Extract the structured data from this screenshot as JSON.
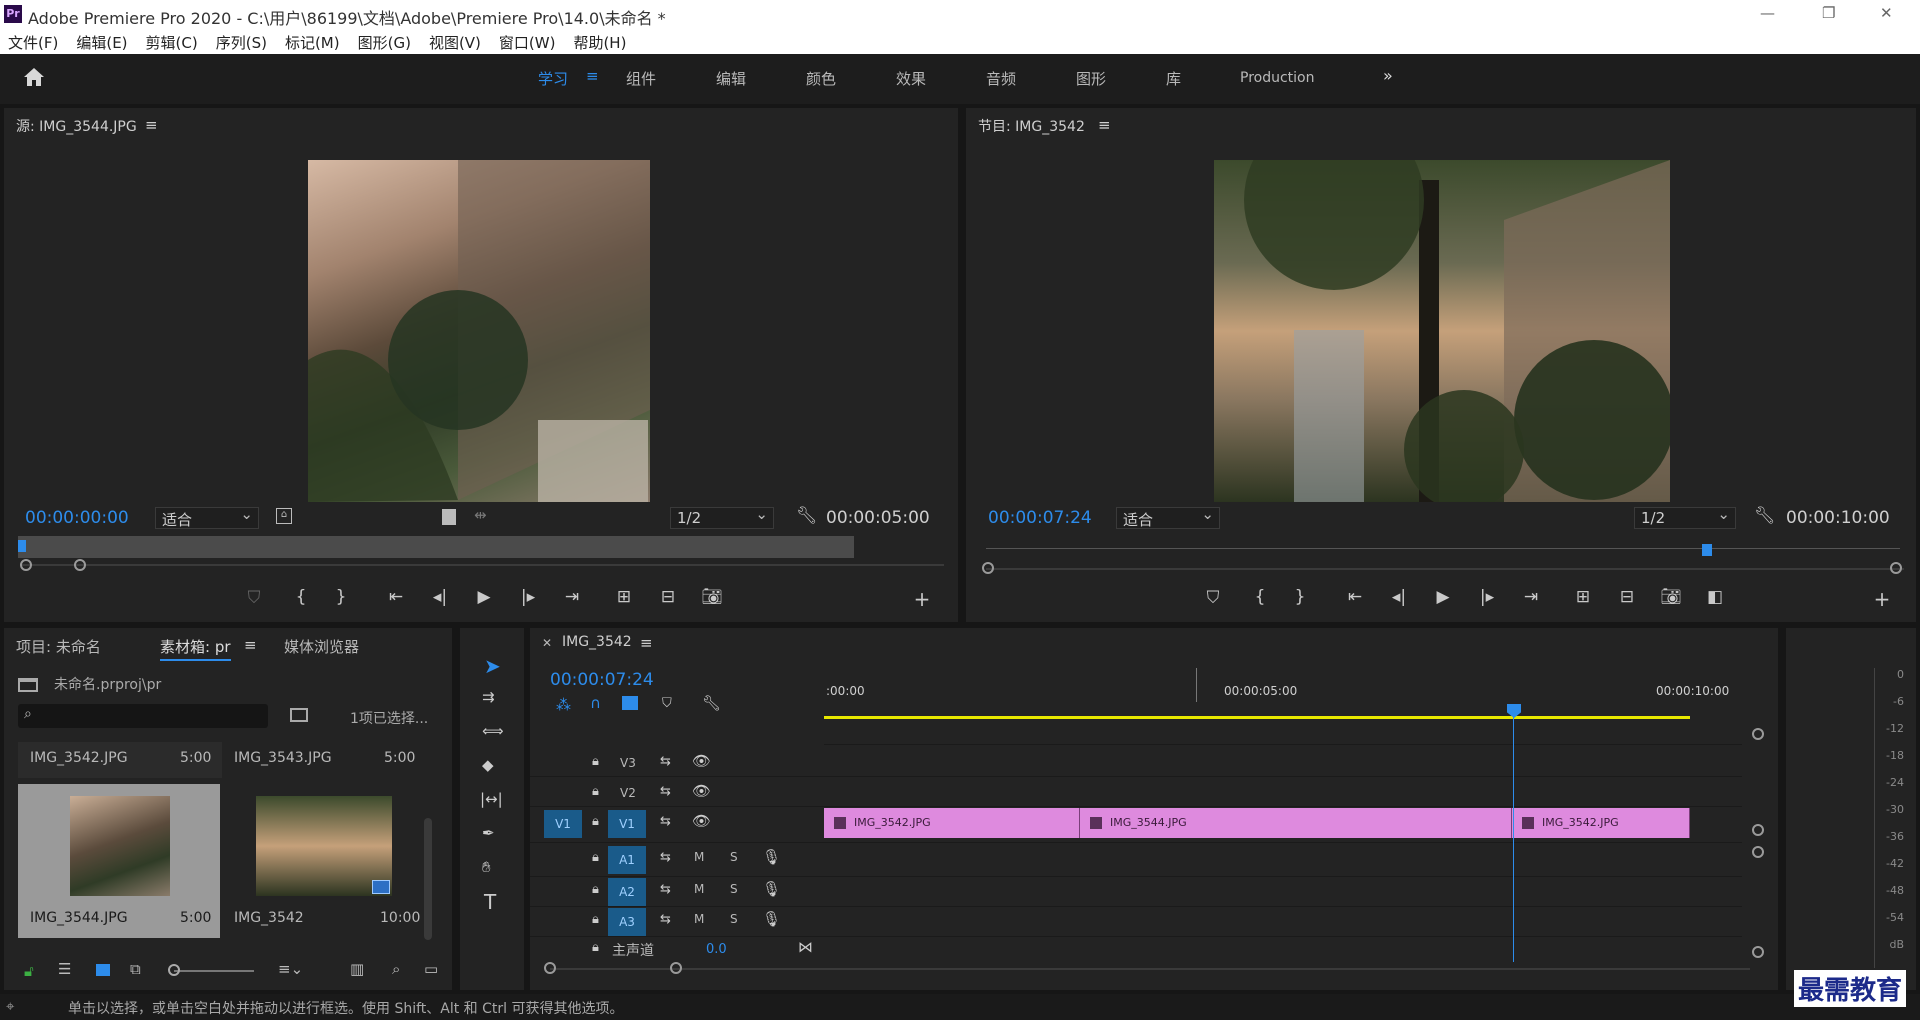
{
  "app": {
    "title": "Adobe Premiere Pro 2020 - C:\\用户\\86199\\文档\\Adobe\\Premiere Pro\\14.0\\未命名 *",
    "logo": "Pr"
  },
  "window_controls": {
    "min": "—",
    "max": "❐",
    "close": "✕"
  },
  "menu": [
    "文件(F)",
    "编辑(E)",
    "剪辑(C)",
    "序列(S)",
    "标记(M)",
    "图形(G)",
    "视图(V)",
    "窗口(W)",
    "帮助(H)"
  ],
  "workspaces": [
    "学习",
    "组件",
    "编辑",
    "颜色",
    "效果",
    "音频",
    "图形",
    "库",
    "Production"
  ],
  "workspace_active": "学习",
  "source": {
    "title": "源: IMG_3544.JPG",
    "timecode": "00:00:00:00",
    "fit": "适合",
    "res": "1/2",
    "duration": "00:00:05:00"
  },
  "program": {
    "title": "节目: IMG_3542",
    "timecode": "00:00:07:24",
    "fit": "适合",
    "res": "1/2",
    "duration": "00:00:10:00"
  },
  "project": {
    "tabs": [
      "项目: 未命名",
      "素材箱: pr",
      "媒体浏览器"
    ],
    "active_tab": "素材箱: pr",
    "path": "未命名.prproj\\pr",
    "selection": "1项已选择...",
    "items": [
      {
        "name": "IMG_3542.JPG",
        "dur": "5:00"
      },
      {
        "name": "IMG_3543.JPG",
        "dur": "5:00"
      },
      {
        "name": "IMG_3544.JPG",
        "dur": "5:00"
      },
      {
        "name": "IMG_3542",
        "dur": "10:00"
      }
    ]
  },
  "timeline": {
    "tab": "IMG_3542",
    "timecode": "00:00:07:24",
    "ruler": [
      ":00:00",
      "00:00:05:00",
      "00:00:10:00"
    ],
    "video_tracks": [
      "V3",
      "V2",
      "V1"
    ],
    "audio_tracks": [
      "A1",
      "A2",
      "A3"
    ],
    "source_patch": "V1",
    "mute": "M",
    "solo": "S",
    "master": {
      "label": "主声道",
      "value": "0.0"
    },
    "clips": [
      "IMG_3542.JPG",
      "IMG_3544.JPG",
      "IMG_3542.JPG"
    ]
  },
  "meter": {
    "labels": [
      "0",
      "-6",
      "-12",
      "-18",
      "-24",
      "-30",
      "-36",
      "-42",
      "-48",
      "-54",
      "dB"
    ]
  },
  "status": "单击以选择，或单击空白处并拖动以进行框选。使用 Shift、Alt 和 Ctrl 可获得其他选项。",
  "watermark": "最需教育",
  "colors": {
    "accent": "#2d8ceb",
    "clip": "#de8ade",
    "playhead": "#2d8ceb",
    "workarea": "#e8e800"
  }
}
